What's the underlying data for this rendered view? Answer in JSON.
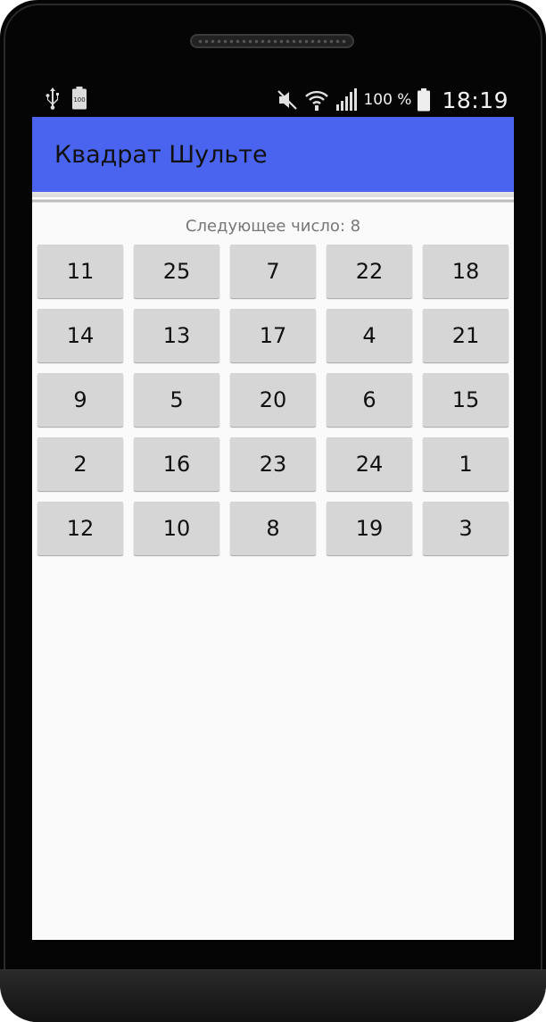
{
  "status_bar": {
    "battery_percent": "100 %",
    "time": "18:19",
    "left_icons": [
      "usb-icon",
      "battery-full-icon"
    ],
    "right_icons": [
      "mute-icon",
      "wifi-icon",
      "signal-icon",
      "battery-icon"
    ]
  },
  "app": {
    "title": "Квадрат Шульте",
    "accent_color": "#4a64f0"
  },
  "game": {
    "hint": "Следующее число: 8",
    "cells": [
      "11",
      "25",
      "7",
      "22",
      "18",
      "14",
      "13",
      "17",
      "4",
      "21",
      "9",
      "5",
      "20",
      "6",
      "15",
      "2",
      "16",
      "23",
      "24",
      "1",
      "12",
      "10",
      "8",
      "19",
      "3"
    ]
  }
}
